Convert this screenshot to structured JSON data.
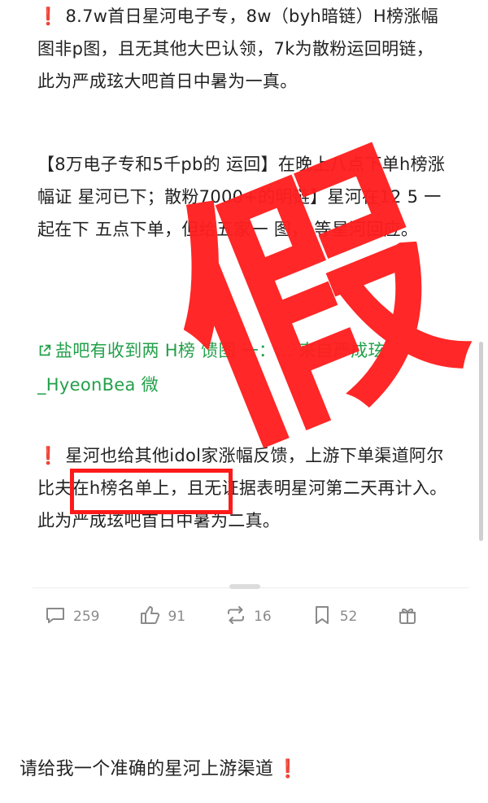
{
  "post": {
    "p1_text": "8.7w首日星河电子专，8w（byh暗链）H榜涨幅图非p图，且无其他大巴认领，7k为散粉运回明链，此为严成玹大吧首日中暑为一真。",
    "p2_text": "【8万电子专和5千pb的 运回】在晚上八点下单h榜涨幅证 星河已下；散粉7000+的明链】星河在12 5 一起在下 五点下单，但给五家一 图， 等星河回应。",
    "p3_text": "盐吧有收到两 H榜 馈图 一：... 来自严成玹_HyeonBea 微",
    "p4_before": "星河也给其他idol家涨幅反馈，上游下单渠道",
    "p4_highlight": "阿尔比夫在h榜名",
    "p4_after": "单上，且无证据表明星河第二天再计入。此为严成玹吧首日中暑为二真。",
    "bang": "❗",
    "overlay_mark": "假"
  },
  "actions": {
    "comments": "259",
    "likes": "91",
    "reposts": "16",
    "saves": "52"
  },
  "bottom": {
    "text": "请给我一个准确的星河上游渠道",
    "bang": "❗"
  },
  "colors": {
    "alert_red": "#e01b1b",
    "link_green": "#23a04a",
    "mark_red": "#ff1f1f"
  }
}
